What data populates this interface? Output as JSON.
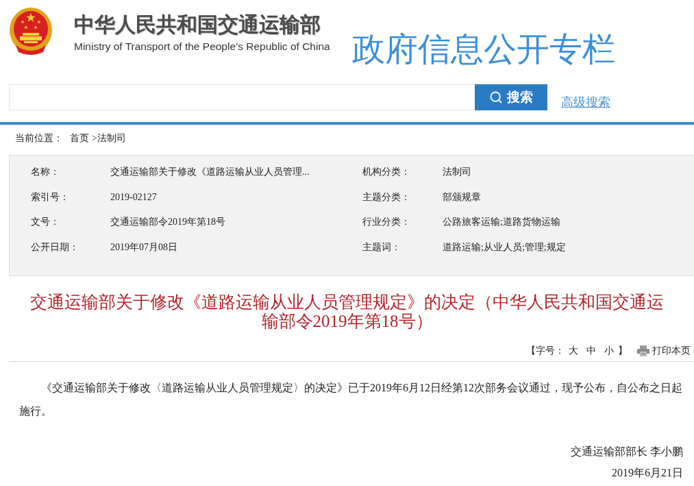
{
  "header": {
    "title": "中华人民共和国交通运输部",
    "subtitle": "Ministry of Transport of the People’s Republic of China",
    "column_title": "政府信息公开专栏"
  },
  "search": {
    "button": "搜索",
    "advanced_link": "高级搜索"
  },
  "breadcrumb": {
    "label": "当前位置：",
    "items": [
      "首页",
      ">法制司"
    ]
  },
  "metadata": [
    {
      "fields": [
        {
          "label": "名称：",
          "value": "交通运输部关于修改《道路运输从业人员管理..."
        },
        {
          "label": "机构分类：",
          "value": "法制司"
        }
      ]
    },
    {
      "fields": [
        {
          "label": "索引号：",
          "value": "2019-02127"
        },
        {
          "label": "主题分类：",
          "value": "部颁规章"
        }
      ]
    },
    {
      "fields": [
        {
          "label": "文号：",
          "value": "交通运输部令2019年第18号"
        },
        {
          "label": "行业分类：",
          "value": "公路旅客运输;道路货物运输"
        }
      ]
    },
    {
      "fields": [
        {
          "label": "公开日期：",
          "value": "2019年07月08日"
        },
        {
          "label": "主题词：",
          "value": "道路运输;从业人员;管理;规定"
        }
      ]
    }
  ],
  "article": {
    "title": "交通运输部关于修改《道路运输从业人员管理规定》的决定（中华人民共和国交通运输部令2019年第18号）",
    "font_size": {
      "open": "【字号：",
      "options": [
        "大",
        "中",
        "小"
      ],
      "close": "】"
    },
    "print": "打印本页",
    "paragraphs": [
      "《交通运输部关于修改〈道路运输从业人员管理规定〉的决定》已于2019年6月12日经第12次部务会议通过，现予公布，自公布之日起施行。"
    ],
    "signature": [
      "交通运输部部长 李小鹏",
      "2019年6月21日"
    ]
  }
}
